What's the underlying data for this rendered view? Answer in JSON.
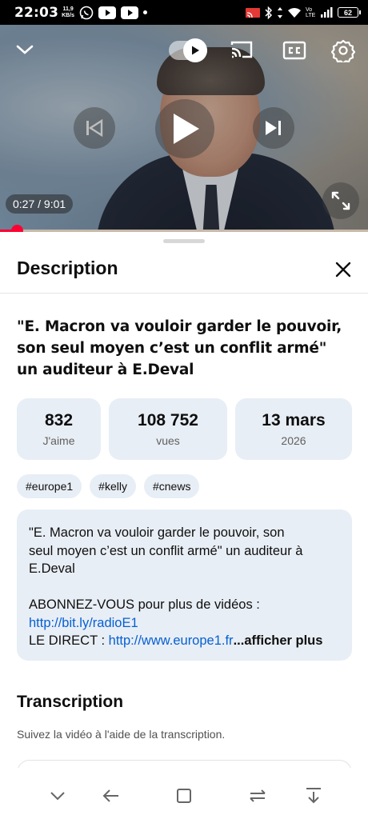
{
  "status_bar": {
    "time": "22:03",
    "net_speed_value": "11,9",
    "net_speed_unit": "KB/s",
    "battery": "62",
    "signal_label": "Vo LTE"
  },
  "player": {
    "timecode": "0:27 / 9:01",
    "progress_fraction": 0.05,
    "autoplay_on": true
  },
  "description": {
    "sheet_title": "Description",
    "video_title": "\"E. Macron va vouloir garder le pouvoir, son seul moyen c’est un conflit armé\" un auditeur à E.Deval",
    "stats": [
      {
        "value": "832",
        "label": "J'aime"
      },
      {
        "value": "108 752",
        "label": "vues"
      },
      {
        "value": "13 mars",
        "label": "2026"
      }
    ],
    "tags": [
      "#europe1",
      "#kelly",
      "#cnews"
    ],
    "body_lines": [
      "\"E. Macron va vouloir garder le pouvoir, son",
      "seul moyen c’est un conflit armé\" un auditeur à",
      "E.Deval"
    ],
    "subscribe_text": "ABONNEZ-VOUS pour plus de vidéos :",
    "subscribe_link": "http://bit.ly/radioE1",
    "direct_label": "LE DIRECT : ",
    "direct_link": "http://www.europe1.fr",
    "more_label": "...afficher plus"
  },
  "transcription": {
    "title": "Transcription",
    "subtitle": "Suivez la vidéo à l'aide de la transcription."
  },
  "colors": {
    "accent_red": "#ff0033",
    "link_blue": "#065fd4",
    "card_bg": "#e8eef5"
  },
  "icons": [
    "chevron-down-icon",
    "autoplay-toggle-icon",
    "cast-icon",
    "cc-icon",
    "settings-icon",
    "previous-icon",
    "play-icon",
    "next-icon",
    "fullscreen-icon",
    "close-icon"
  ]
}
